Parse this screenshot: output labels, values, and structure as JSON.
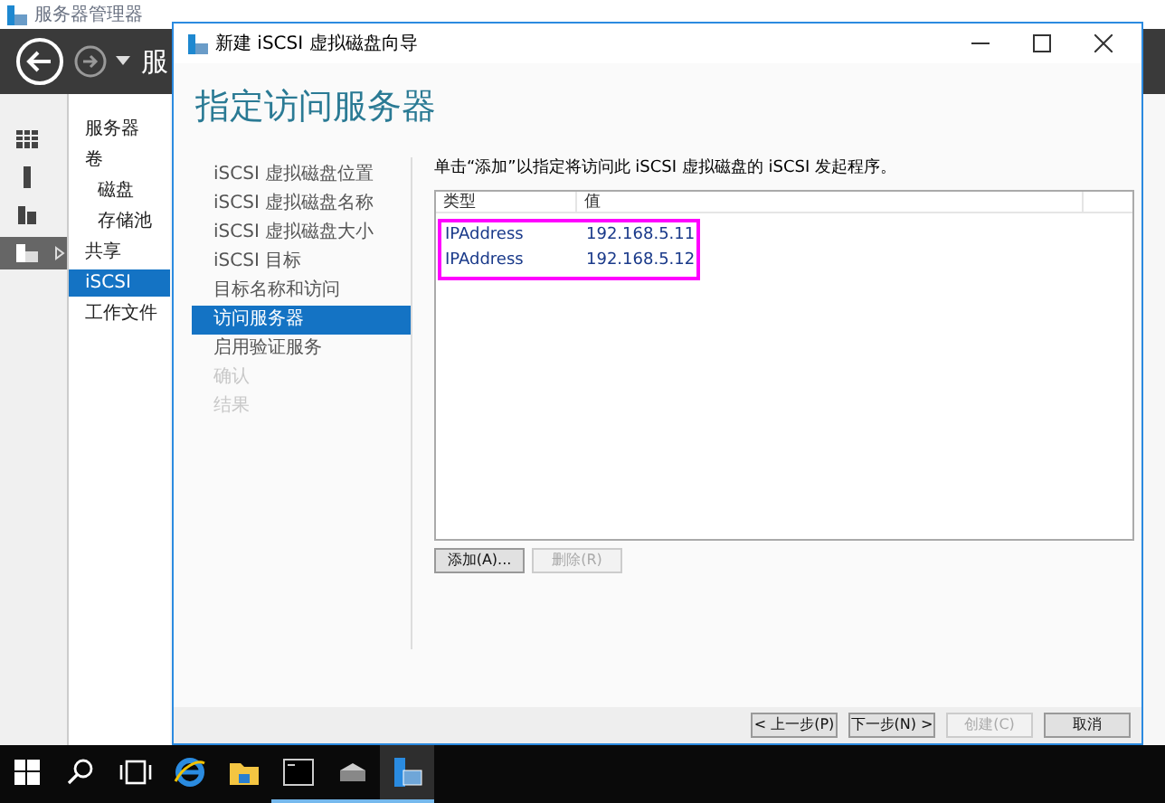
{
  "app": {
    "title": "服务器管理器",
    "header_title": "服"
  },
  "nav_icons": [
    {
      "kind": "dashboard",
      "selected": false
    },
    {
      "kind": "server",
      "selected": false
    },
    {
      "kind": "servers",
      "selected": false
    },
    {
      "kind": "storage",
      "selected": true
    }
  ],
  "nav": [
    {
      "label": "服务器",
      "selected": false
    },
    {
      "label": "卷",
      "selected": false,
      "children": [
        {
          "label": "磁盘",
          "selected": false
        },
        {
          "label": "存储池",
          "selected": false
        }
      ]
    },
    {
      "label": "共享",
      "selected": false
    },
    {
      "label": "iSCSI",
      "selected": true
    },
    {
      "label": "工作文件",
      "selected": false
    }
  ],
  "wizard": {
    "title": "新建 iSCSI 虚拟磁盘向导",
    "heading": "指定访问服务器",
    "steps": [
      {
        "label": "iSCSI 虚拟磁盘位置",
        "selected": false,
        "disabled": false
      },
      {
        "label": "iSCSI 虚拟磁盘名称",
        "selected": false,
        "disabled": false
      },
      {
        "label": "iSCSI 虚拟磁盘大小",
        "selected": false,
        "disabled": false
      },
      {
        "label": "iSCSI 目标",
        "selected": false,
        "disabled": false
      },
      {
        "label": "目标名称和访问",
        "selected": false,
        "disabled": false
      },
      {
        "label": "访问服务器",
        "selected": true,
        "disabled": false
      },
      {
        "label": "启用验证服务",
        "selected": false,
        "disabled": false
      },
      {
        "label": "确认",
        "selected": false,
        "disabled": true
      },
      {
        "label": "结果",
        "selected": false,
        "disabled": true
      }
    ],
    "instruction": "单击“添加”以指定将访问此 iSCSI 虚拟磁盘的 iSCSI 发起程序。",
    "table": {
      "columns": [
        "类型",
        "值"
      ],
      "rows": [
        {
          "type": "IPAddress",
          "value": "192.168.5.11"
        },
        {
          "type": "IPAddress",
          "value": "192.168.5.12"
        }
      ]
    },
    "table_buttons": [
      {
        "label": "添加(A)...",
        "disabled": false
      },
      {
        "label": "删除(R)",
        "disabled": true
      }
    ],
    "footer_buttons": [
      {
        "label": "< 上一步(P)",
        "disabled": false
      },
      {
        "label": "下一步(N) >",
        "disabled": false
      },
      {
        "label": "创建(C)",
        "disabled": true
      },
      {
        "label": "取消",
        "disabled": false
      }
    ]
  },
  "taskbar": [
    {
      "kind": "start",
      "running": false
    },
    {
      "kind": "search",
      "running": false
    },
    {
      "kind": "taskview",
      "running": false
    },
    {
      "kind": "browser",
      "running": false
    },
    {
      "kind": "folder",
      "running": false
    },
    {
      "kind": "console",
      "running": true
    },
    {
      "kind": "drive",
      "running": true
    },
    {
      "kind": "servermanager",
      "running": true
    }
  ]
}
